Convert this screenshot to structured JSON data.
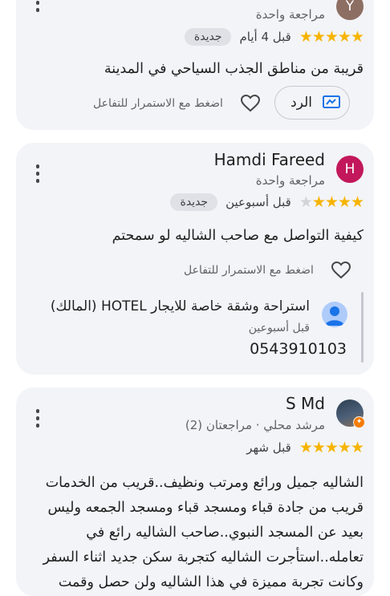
{
  "reviews": [
    {
      "avatar_letter": "Y",
      "meta": "مراجعة واحدة",
      "rating": 5,
      "time": "قبل 4 أيام",
      "badge": "جديدة",
      "text": "قريبة من مناطق الجذب السياحي في المدينة",
      "reply_button": "الرد",
      "like_hint": "اضغط مع الاستمرار للتفاعل"
    },
    {
      "avatar_letter": "H",
      "name": "Hamdi Fareed",
      "meta": "مراجعة واحدة",
      "rating": 4,
      "time": "قبل أسبوعين",
      "badge": "جديدة",
      "text": "كيفية التواصل مع صاحب الشاليه لو سمحتم",
      "like_hint": "اضغط مع الاستمرار للتفاعل",
      "owner_reply": {
        "name": "استراحة وشقة خاصة للايجار HOTEL (المالك)",
        "time": "قبل أسبوعين",
        "text": "0543910103"
      }
    },
    {
      "name": "S Md",
      "meta": "مرشد محلي · مراجعتان (2)",
      "rating": 5,
      "time": "قبل شهر",
      "text_lines": [
        "الشاليه جميل ورائع ومرتب ونظيف..قريب من الخدمات",
        "قريب من جادة قباء ومسجد قباء ومسجد الجمعه وليس",
        "بعيد عن المسجد النبوي..صاحب الشاليه رائع في",
        "تعامله..استأجرت الشاليه كتجربة سكن جديد اثناء السفر",
        "وكانت تجربة مميزة في هذا الشاليه ولن حصل وقمت"
      ]
    }
  ],
  "colors": {
    "card_bg": "#f3f4f8",
    "star": "#f6b400",
    "accent": "#1a73e8",
    "avatar_h": "#c2185b",
    "avatar_y": "#8d6e63",
    "owner_avatar": "#aecbfa"
  },
  "icons": [
    "more-vert-icon",
    "heart-outline-icon",
    "reply-icon",
    "star-icon",
    "local-guide-badge-icon",
    "person-icon"
  ]
}
